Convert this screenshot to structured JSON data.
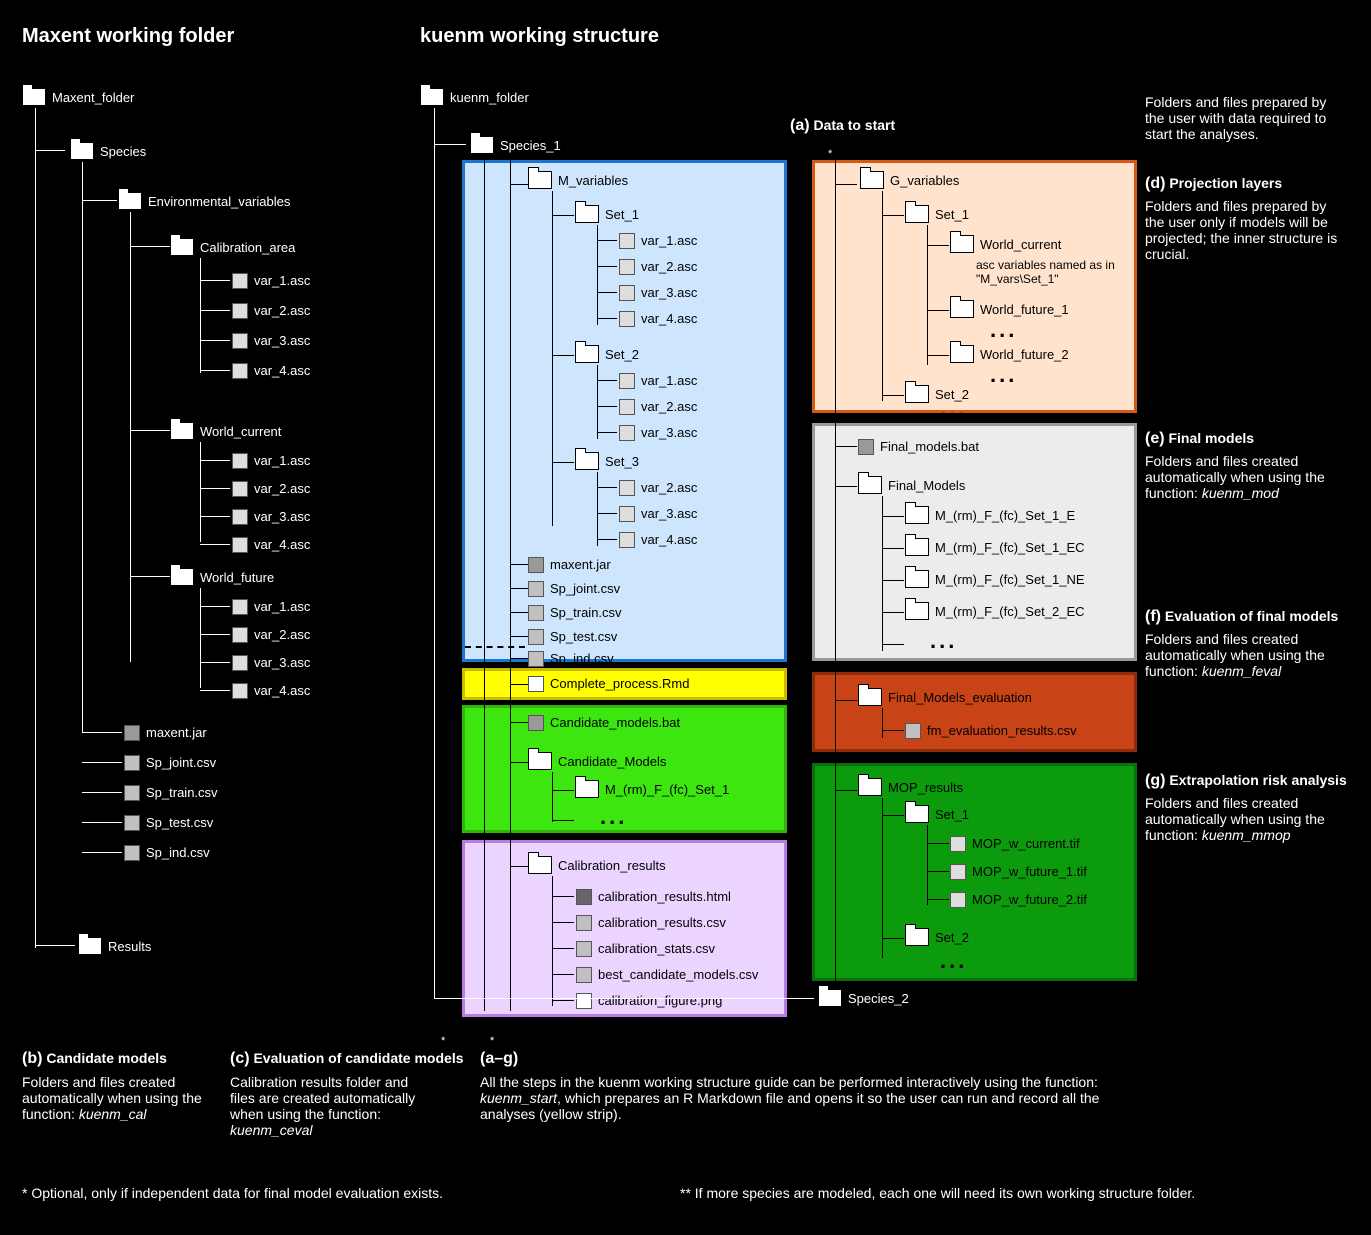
{
  "headers": {
    "left": "Maxent working folder",
    "right": "kuenm working structure"
  },
  "left_tree": {
    "root": "Maxent_folder",
    "species": "Species",
    "env_vars": "Environmental_variables",
    "calibration": {
      "label": "Calibration_area",
      "files": [
        "var_1.asc",
        "var_2.asc",
        "var_3.asc",
        "var_4.asc"
      ]
    },
    "current": {
      "label": "World_current",
      "files": [
        "var_1.asc",
        "var_2.asc",
        "var_3.asc",
        "var_4.asc"
      ]
    },
    "future": {
      "label": "World_future",
      "files": [
        "var_1.asc",
        "var_2.asc",
        "var_3.asc",
        "var_4.asc"
      ]
    },
    "root_files": [
      "maxent.jar",
      "Sp_joint.csv",
      "Sp_train.csv",
      "Sp_test.csv",
      "Sp_ind.csv"
    ],
    "results": "Results"
  },
  "right_tree": {
    "root": "kuenm_folder",
    "species": "Species_1",
    "mvars": {
      "label": "M_variables",
      "sets": {
        "set1": {
          "label": "Set_1",
          "files": [
            "var_1.asc",
            "var_2.asc",
            "var_3.asc",
            "var_4.asc"
          ]
        },
        "set2": {
          "label": "Set_2",
          "files": [
            "var_1.asc",
            "var_2.asc",
            "var_3.asc"
          ]
        },
        "set3": {
          "label": "Set_3",
          "files": [
            "var_2.asc",
            "var_3.asc",
            "var_4.asc"
          ]
        }
      }
    },
    "species_files": [
      "maxent.jar",
      "Sp_joint.csv",
      "Sp_train.csv",
      "Sp_test.csv",
      "Sp_ind.csv"
    ],
    "complete_process": "Complete_process.Rmd",
    "candidate_bat": "Candidate_models.bat",
    "candidate_models": {
      "label": "Candidate_Models",
      "child": "M_(rm)_F_(fc)_Set_1"
    },
    "calibration_results": {
      "label": "Calibration_results",
      "files": [
        "calibration_results.html",
        "calibration_results.csv",
        "calibration_stats.csv",
        "best_candidate_models.csv",
        "calibration_figure.png"
      ]
    },
    "gvars": {
      "label": "G_variables",
      "set1": {
        "label": "Set_1",
        "world_current": "World_current",
        "note": "asc variables named as in \"M_vars\\Set_1\"",
        "future1": "World_future_1",
        "future2": "World_future_2"
      },
      "set2": "Set_2"
    },
    "final_bat": "Final_models.bat",
    "final_models": {
      "label": "Final_Models",
      "children": [
        "M_(rm)_F_(fc)_Set_1_E",
        "M_(rm)_F_(fc)_Set_1_EC",
        "M_(rm)_F_(fc)_Set_1_NE",
        "M_(rm)_F_(fc)_Set_2_EC"
      ]
    },
    "fme": {
      "label": "Final_Models_evaluation",
      "file": "fm_evaluation_results.csv"
    },
    "mop": {
      "label": "MOP_results",
      "set1": {
        "label": "Set_1",
        "files": [
          "MOP_w_current.tif",
          "MOP_w_future_1.tif",
          "MOP_w_future_2.tif"
        ]
      },
      "set2": "Set_2"
    },
    "species2": "Species_2"
  },
  "captions": {
    "a": {
      "title": "(a)",
      "subtitle": "Data to start",
      "body": "Folders and files prepared by the user with data required to start the analyses."
    },
    "b": {
      "title": "(b)",
      "subtitle": "Candidate models",
      "body1": "Folders and files created automatically when using the function:",
      "fn": "kuenm_cal"
    },
    "c": {
      "title": "(c)",
      "subtitle": "Evaluation of candidate models",
      "body": "Calibration results folder and files are created automatically when using the function:",
      "fn": "kuenm_ceval"
    },
    "d": {
      "title": "(d)",
      "subtitle": "Projection layers",
      "body": "Folders and files prepared by the user only if models will be projected; the inner structure is crucial."
    },
    "e": {
      "title": "(e)",
      "subtitle": "Final models",
      "body": "Folders and files created automatically when using the function:",
      "fn": "kuenm_mod"
    },
    "f": {
      "title": "(f)",
      "subtitle": "Evaluation of final models",
      "body": "Folders and files created automatically when using the function:",
      "fn": "kuenm_feval"
    },
    "g": {
      "title": "(g)",
      "subtitle": "Extrapolation risk analysis",
      "body": "Folders and files created automatically when using the function:",
      "fn": "kuenm_mmop"
    },
    "all": {
      "title": "(a–g)",
      "body": "All the steps in the kuenm working structure guide can be performed interactively using the function:",
      "fn": "kuenm_start",
      "tail": ", which prepares an R Markdown file and opens it so the user can run and record all the analyses (yellow strip)."
    },
    "bottom_left": "Optional, only if independent data for final model evaluation exists.",
    "bottom_right": "If more species are modeled, each one will need its own working structure folder.",
    "ellipsis": "..."
  }
}
